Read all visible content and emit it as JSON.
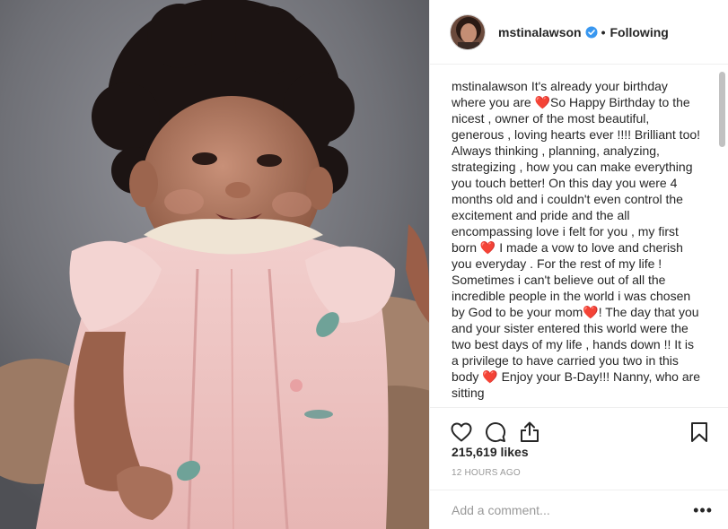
{
  "post": {
    "image_alt": "Baby in pink dress"
  },
  "header": {
    "username": "mstinalawson",
    "separator": "•",
    "follow_status": "Following",
    "verified_icon": "verified-badge-icon",
    "accent": "#3897f0"
  },
  "caption": {
    "username": "mstinalawson",
    "text": "It's already your birthday where you are ❤️So Happy Birthday to the nicest , owner of the most beautiful, generous , loving hearts ever !!!! Brilliant too! Always thinking , planning, analyzing, strategizing , how you can make everything you touch better! On this day you were 4 months old and i couldn't even control the excitement and pride and the all encompassing love i felt for you , my first born ❤️ I made a vow to love and cherish you everyday . For the rest of my life ! Sometimes i can't believe out of all the incredible people in the world i was chosen by God to be your mom❤️! The day that you and your sister entered this world were the two best days of my life , hands down !! It is a privilege to have carried you two in this body ❤️ Enjoy your B-Day!!! Nanny, who are sitting"
  },
  "actions": {
    "like_icon": "heart-outline-icon",
    "comment_icon": "comment-bubble-icon",
    "share_icon": "share-upload-icon",
    "save_icon": "bookmark-icon"
  },
  "stats": {
    "likes": "215,619 likes",
    "time": "12 HOURS AGO"
  },
  "comment": {
    "placeholder": "Add a comment...",
    "more_label": "•••"
  }
}
